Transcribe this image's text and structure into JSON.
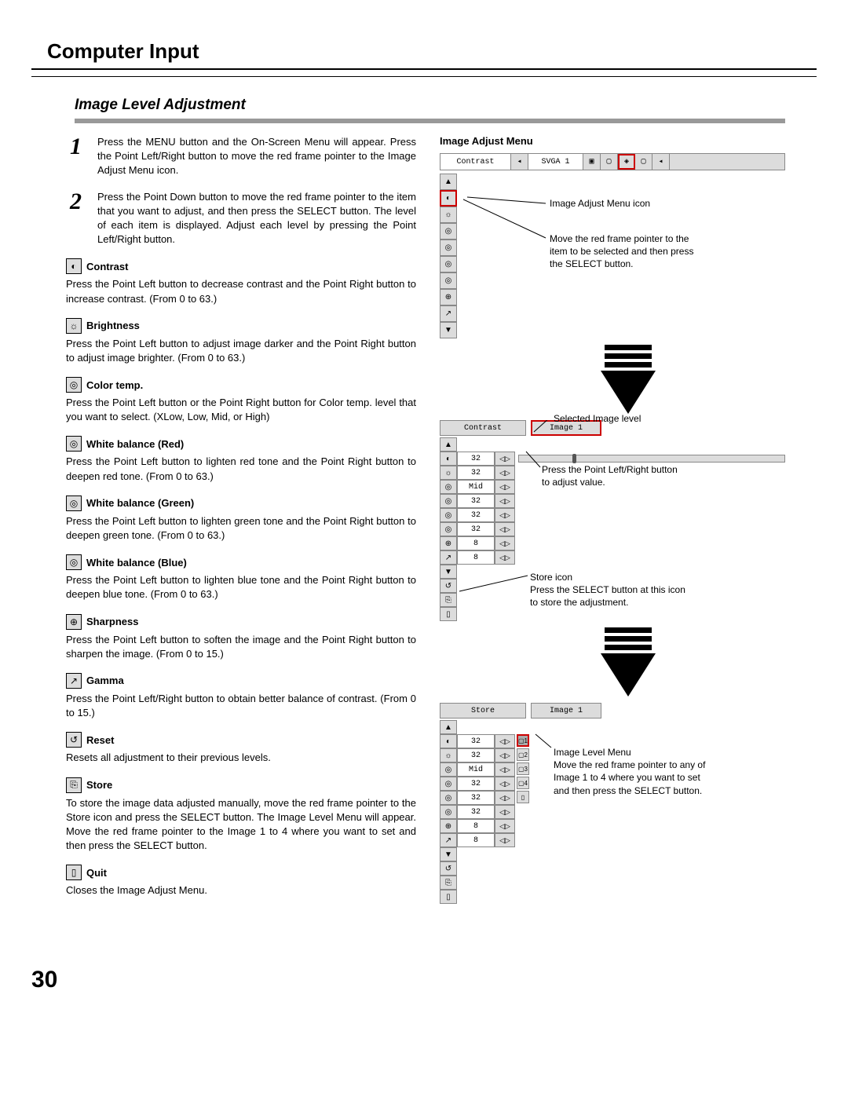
{
  "page": {
    "title": "Computer Input",
    "section": "Image Level Adjustment",
    "number": "30"
  },
  "steps": [
    {
      "num": "1",
      "text": "Press the MENU button and the On-Screen Menu will appear. Press the Point Left/Right button to move the red frame pointer to the Image Adjust Menu icon."
    },
    {
      "num": "2",
      "text": "Press the Point Down button to move the red frame pointer to the item that you want to adjust, and then press the SELECT button.  The level of each item is displayed.  Adjust each level by pressing the Point Left/Right button."
    }
  ],
  "params": [
    {
      "icon": "◐",
      "title": "Contrast",
      "desc": "Press the Point Left button to decrease contrast and the Point Right button to increase contrast.  (From 0 to 63.)"
    },
    {
      "icon": "☼",
      "title": "Brightness",
      "desc": "Press the Point Left button to adjust image darker and the Point Right button to adjust image brighter.  (From 0 to 63.)"
    },
    {
      "icon": "◎",
      "title": "Color temp.",
      "desc": "Press the Point Left button or the Point Right  button for Color temp. level that you want to select. (XLow, Low, Mid, or High)"
    },
    {
      "icon": "◎",
      "title": "White balance (Red)",
      "desc": "Press the Point Left button to lighten red tone and the Point Right button to deepen red tone.  (From 0 to 63.)"
    },
    {
      "icon": "◎",
      "title": "White balance (Green)",
      "desc": "Press the Point Left button to lighten green tone and the Point Right button to deepen green tone.  (From 0 to 63.)"
    },
    {
      "icon": "◎",
      "title": "White balance (Blue)",
      "desc": "Press the Point Left button to lighten blue tone and the Point Right button to deepen blue tone.  (From 0 to 63.)"
    },
    {
      "icon": "⊕",
      "title": "Sharpness",
      "desc": "Press the Point Left button to soften the image and the Point Right button to sharpen the image.  (From 0 to 15.)"
    },
    {
      "icon": "↗",
      "title": "Gamma",
      "desc": "Press the Point Left/Right  button to obtain better balance of contrast. (From 0 to 15.)"
    },
    {
      "icon": "↺",
      "title": "Reset",
      "desc": "Resets all adjustment to their previous levels."
    },
    {
      "icon": "⎘",
      "title": "Store",
      "desc": "To store the image data adjusted manually, move the red frame pointer to the Store icon and press the SELECT button.  The Image Level Menu will appear.  Move the red frame pointer to the Image 1 to 4 where you want to set and then press the SELECT button."
    },
    {
      "icon": "▯",
      "title": "Quit",
      "desc": "Closes the Image Adjust Menu."
    }
  ],
  "right": {
    "title": "Image Adjust Menu",
    "menubar": {
      "label": "Contrast",
      "source": "SVGA 1"
    },
    "callouts": {
      "icon_label": "Image Adjust Menu icon",
      "move_frame": "Move the red frame pointer to the item to be selected and then press the SELECT button.",
      "selected_level": "Selected Image level",
      "press_lr": "Press the Point Left/Right button to adjust value.",
      "store_icon": "Store icon\nPress the SELECT button at this icon to store the adjustment.",
      "image_level_menu": "Image Level Menu\nMove the red frame pointer to any of Image 1 to 4 where you want to set  and then press the SELECT button."
    },
    "panel2": {
      "header_left": "Contrast",
      "header_right": "Image 1",
      "rows": [
        {
          "v": "32"
        },
        {
          "v": "32"
        },
        {
          "v": "Mid"
        },
        {
          "v": "32"
        },
        {
          "v": "32"
        },
        {
          "v": "32"
        },
        {
          "v": "8"
        },
        {
          "v": "8"
        }
      ]
    },
    "panel3": {
      "header_left": "Store",
      "header_right": "Image 1",
      "rows": [
        {
          "v": "32",
          "t": "1"
        },
        {
          "v": "32",
          "t": "2"
        },
        {
          "v": "Mid",
          "t": "3"
        },
        {
          "v": "32",
          "t": "4"
        },
        {
          "v": "32",
          "t": ""
        },
        {
          "v": "32",
          "t": ""
        },
        {
          "v": "8",
          "t": ""
        },
        {
          "v": "8",
          "t": ""
        }
      ]
    }
  }
}
